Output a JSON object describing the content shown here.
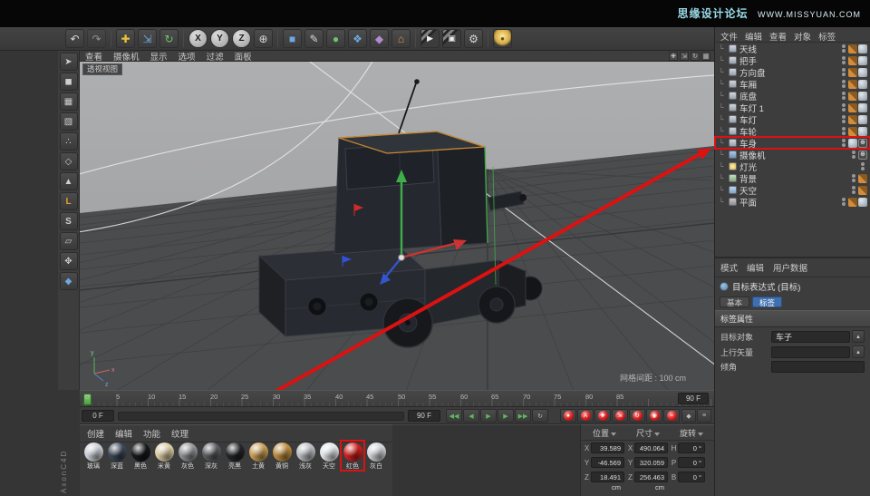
{
  "colors": {
    "accent_red": "#dd1111",
    "selection_blue": "#3f6fae",
    "watermark_cyan": "#9adbe8"
  },
  "watermark": {
    "site": "思缘设计论坛",
    "url": "WWW.MISSYUAN.COM"
  },
  "vertical_watermark": "AxonC4D",
  "toolbar": {
    "icons": [
      {
        "name": "undo",
        "glyph": "↶"
      },
      {
        "name": "redo",
        "glyph": "↷"
      },
      {
        "name": "move-tool",
        "glyph": "✚"
      },
      {
        "name": "scale-tool",
        "glyph": "⇲"
      },
      {
        "name": "rotate-tool",
        "glyph": "↻"
      },
      {
        "name": "axis-x",
        "glyph": "X"
      },
      {
        "name": "axis-y",
        "glyph": "Y"
      },
      {
        "name": "axis-z",
        "glyph": "Z"
      },
      {
        "name": "coord-system",
        "glyph": "⊕"
      },
      {
        "name": "add-cube",
        "glyph": "■"
      },
      {
        "name": "add-spline",
        "glyph": "✎"
      },
      {
        "name": "add-generator",
        "glyph": "●"
      },
      {
        "name": "add-modeling",
        "glyph": "❖"
      },
      {
        "name": "add-deformer",
        "glyph": "◆"
      },
      {
        "name": "add-environment",
        "glyph": "⌂"
      },
      {
        "name": "render-view",
        "glyph": "▶"
      },
      {
        "name": "render-picture",
        "glyph": "▣"
      },
      {
        "name": "render-settings",
        "glyph": "⚙"
      },
      {
        "name": "light",
        "glyph": "●"
      }
    ]
  },
  "left_toolbar": {
    "tools": [
      {
        "name": "live-selection",
        "glyph": "➤"
      },
      {
        "name": "model-mode",
        "glyph": "◼"
      },
      {
        "name": "texture-mode",
        "glyph": "▦"
      },
      {
        "name": "uv-mode",
        "glyph": "▧"
      },
      {
        "name": "points-mode",
        "glyph": "∴"
      },
      {
        "name": "edges-mode",
        "glyph": "◇"
      },
      {
        "name": "polygons-mode",
        "glyph": "▲"
      },
      {
        "name": "axis-mode",
        "glyph": "L"
      },
      {
        "name": "snap-toggle",
        "glyph": "S"
      },
      {
        "name": "workplane",
        "glyph": "▱"
      },
      {
        "name": "magnet-tool",
        "glyph": "✥"
      },
      {
        "name": "viewport-lock",
        "glyph": "◆"
      }
    ]
  },
  "viewport": {
    "menus": [
      "查看",
      "摄像机",
      "显示",
      "选项",
      "过滤",
      "面板"
    ],
    "window_icons": [
      {
        "name": "view-move",
        "glyph": "✚"
      },
      {
        "name": "view-scale",
        "glyph": "⇲"
      },
      {
        "name": "view-rotate",
        "glyph": "↻"
      },
      {
        "name": "view-toggle",
        "glyph": "▦"
      }
    ],
    "view_label": "透视视图",
    "grid_label": "网格间距 : 100 cm",
    "axis_x": "x",
    "axis_y": "y",
    "axis_z": "z"
  },
  "object_manager": {
    "menus": [
      "文件",
      "编辑",
      "查看",
      "对象",
      "标签"
    ],
    "target_tag_glyph": "⊕",
    "items": [
      {
        "label": "天线"
      },
      {
        "label": "把手"
      },
      {
        "label": "方向盘"
      },
      {
        "label": "车厢"
      },
      {
        "label": "底盘"
      },
      {
        "label": "车灯 1"
      },
      {
        "label": "车灯"
      },
      {
        "label": "车轮"
      },
      {
        "label": "车身"
      },
      {
        "label": "摄像机"
      },
      {
        "label": "灯光"
      },
      {
        "label": "背景"
      },
      {
        "label": "天空"
      },
      {
        "label": "平面"
      }
    ],
    "highlighted_item": "车身"
  },
  "attributes": {
    "menus": [
      "模式",
      "编辑",
      "用户数据"
    ],
    "title": "目标表达式 (目标)",
    "tab_basic": "基本",
    "tab_tag": "标签",
    "section": "标签属性",
    "link_button_glyph": "▴",
    "fields": [
      {
        "label": "目标对象",
        "value": "车子"
      },
      {
        "label": "上行矢量",
        "value": ""
      },
      {
        "label": "倾角",
        "value": ""
      }
    ]
  },
  "timeline": {
    "ticks": [
      "0",
      "5",
      "10",
      "15",
      "20",
      "25",
      "30",
      "35",
      "40",
      "45",
      "50",
      "55",
      "60",
      "65",
      "70",
      "75",
      "80",
      "85"
    ],
    "current_frame": "0 F",
    "end_frame": "90 F",
    "transport": [
      {
        "name": "goto-start",
        "glyph": "◀◀"
      },
      {
        "name": "prev-frame",
        "glyph": "◀"
      },
      {
        "name": "play",
        "glyph": "▶"
      },
      {
        "name": "next-frame",
        "glyph": "▶"
      },
      {
        "name": "goto-end",
        "glyph": "▶▶"
      },
      {
        "name": "loop",
        "glyph": "↻"
      }
    ],
    "record": [
      {
        "name": "record-keyframe",
        "glyph": "●"
      },
      {
        "name": "autokey",
        "glyph": "A"
      },
      {
        "name": "record-position",
        "glyph": "✚"
      },
      {
        "name": "record-scale",
        "glyph": "⇲"
      },
      {
        "name": "record-rotation",
        "glyph": "↻"
      },
      {
        "name": "record-parameter",
        "glyph": "◉"
      },
      {
        "name": "record-pla",
        "glyph": "≈"
      }
    ],
    "extra": [
      {
        "name": "key-interpolation",
        "glyph": "◆"
      },
      {
        "name": "timeline-options",
        "glyph": "≡"
      }
    ]
  },
  "materials": {
    "menus": [
      "创建",
      "编辑",
      "功能",
      "纹理"
    ],
    "highlighted": "红色",
    "items": [
      {
        "name": "玻璃",
        "color": "#c9ced4"
      },
      {
        "name": "深蓝",
        "color": "#3c4758"
      },
      {
        "name": "黑色",
        "color": "#17181b"
      },
      {
        "name": "米黄",
        "color": "#d9caa2"
      },
      {
        "name": "灰色",
        "color": "#8e9195"
      },
      {
        "name": "深灰",
        "color": "#595c60"
      },
      {
        "name": "亮黑",
        "color": "#232428"
      },
      {
        "name": "土黄",
        "color": "#c69c55"
      },
      {
        "name": "黄铜",
        "color": "#bb8c3f"
      },
      {
        "name": "浅灰",
        "color": "#babdc1"
      },
      {
        "name": "天空",
        "color": "#e0e4e7"
      },
      {
        "name": "红色",
        "color": "#cf1f1f"
      },
      {
        "name": "灰白",
        "color": "#d0d4d7"
      }
    ]
  },
  "coordinates": {
    "columns": [
      "位置",
      "尺寸",
      "旋转"
    ],
    "rows": [
      {
        "axis": "X",
        "position": "39.589 cm",
        "size_axis": "X",
        "size": "490.064 cm",
        "rot_axis": "H",
        "rotation": "0 °"
      },
      {
        "axis": "Y",
        "position": "-46.569 cm",
        "size_axis": "Y",
        "size": "320.059 cm",
        "rot_axis": "P",
        "rotation": "0 °"
      },
      {
        "axis": "Z",
        "position": "18.491 cm",
        "size_axis": "Z",
        "size": "256.463 cm",
        "rot_axis": "B",
        "rotation": "0 °"
      }
    ]
  }
}
